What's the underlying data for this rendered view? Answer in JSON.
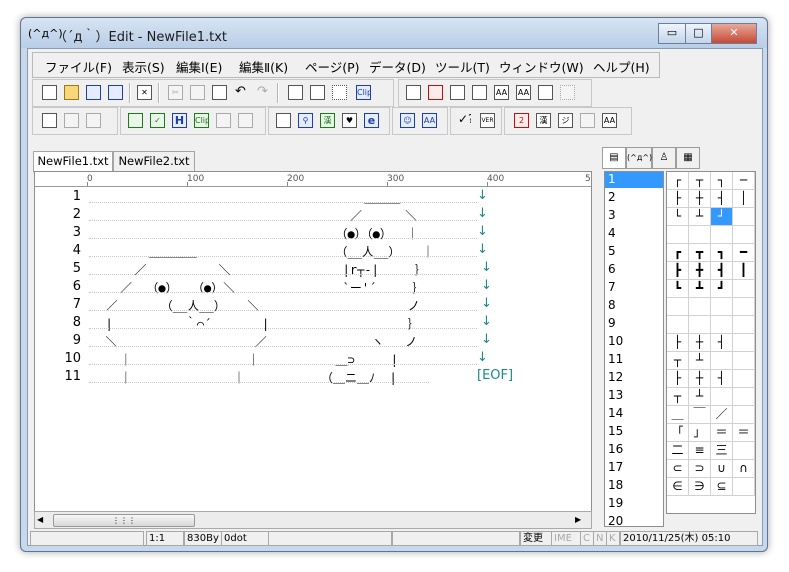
{
  "window": {
    "icon_text": "(^д^)",
    "title": "（´д｀）Edit - NewFile1.txt",
    "minimize_label": "▭",
    "maximize_label": "□",
    "close_label": "✕"
  },
  "menu": [
    "ファイル(F)",
    "表示(S)",
    "編集Ⅰ(E)",
    "編集Ⅱ(K)",
    "ページ(P)",
    "データ(D)",
    "ツール(T)",
    "ウィンドウ(W)",
    "ヘルプ(H)"
  ],
  "toolbar_icons": {
    "new": "new-file-icon",
    "open": "open-folder-icon",
    "save": "save-icon",
    "save_as": "save-as-icon",
    "close_doc": "close-document-icon",
    "cut": "cut-icon",
    "copy": "copy-icon",
    "paste": "paste-icon",
    "undo": "undo-icon",
    "redo": "redo-icon"
  },
  "toolbar_labels": {
    "clip": "Clip",
    "h": "H",
    "e": "e",
    "ver": "VER",
    "aa": "AA",
    "heart": "♥",
    "kan": "漢",
    "two": "2",
    "jiro": "ジ",
    "clip2": "Clip"
  },
  "tabs": [
    "NewFile1.txt",
    "NewFile2.txt"
  ],
  "ruler": [
    "0",
    "100",
    "200",
    "300",
    "400",
    "5"
  ],
  "line_numbers": [
    "1",
    "2",
    "3",
    "4",
    "5",
    "6",
    "7",
    "8",
    "9",
    "10",
    "11"
  ],
  "editor": {
    "eof": "[EOF]",
    "arrow": "↓",
    "aa_left": [
      "",
      "",
      "",
      "        ＿＿＿＿",
      "      ／          ＼",
      "    ／  （●）  （●）＼",
      "  ／      （__人__）   ＼",
      "  |          ｀⌒´       |",
      "  ＼                   ／",
      "    ｜                ｜",
      "    ｜              ｜"
    ],
    "aa_right": [
      "      ＿＿＿",
      "    ／      ＼",
      "  （●）（●）  ｜",
      "  （__人__）   ｜",
      "   |r┬-|     ｝",
      "   `ー'´     ｝",
      "            ノ",
      "            ｝",
      "       ヽ   ノ",
      "  ＿⊃     |",
      "（＿ニ＿ﾉ  |"
    ]
  },
  "side_tabs": [
    "list-icon",
    "(^д^)",
    "person-icon",
    "grid-icon"
  ],
  "pages": [
    "1",
    "2",
    "3",
    "4",
    "5",
    "6",
    "7",
    "8",
    "9",
    "10",
    "11",
    "12",
    "13",
    "14",
    "15",
    "16",
    "17",
    "18",
    "19",
    "20"
  ],
  "parts_grid": [
    [
      "┌",
      "┬",
      "┐",
      "─"
    ],
    [
      "├",
      "┼",
      "┤",
      "│"
    ],
    [
      "└",
      "┴",
      "┘",
      ""
    ],
    [
      "",
      "",
      "",
      ""
    ],
    [
      "┏",
      "┳",
      "┓",
      "━"
    ],
    [
      "┣",
      "╋",
      "┫",
      "┃"
    ],
    [
      "┗",
      "┻",
      "┛",
      ""
    ],
    [
      "",
      "",
      "",
      ""
    ],
    [
      "",
      "",
      "",
      ""
    ],
    [
      "├",
      "┼",
      "┤",
      ""
    ],
    [
      "┬",
      "┴",
      "",
      ""
    ],
    [
      "├",
      "┼",
      "┤",
      ""
    ],
    [
      "┬",
      "┴",
      "",
      ""
    ],
    [
      "＿",
      "￣",
      "／／",
      ""
    ],
    [
      "「",
      "」",
      "＝",
      "＝"
    ],
    [
      "二",
      "≡",
      "三",
      ""
    ],
    [
      "⊂",
      "⊃",
      "∪",
      "∩"
    ],
    [
      "∈",
      "∋",
      "⊆",
      ""
    ]
  ],
  "status": {
    "cursor": "1:1",
    "bytes": "830By",
    "dots": "0dot",
    "modified": "変更",
    "ime": "IME",
    "c": "C",
    "n": "N",
    "k": "K",
    "datetime": "2010/11/25(木) 05:10"
  },
  "colors": {
    "accent": "#3399ff",
    "eof_color": "#1c8a8a"
  }
}
